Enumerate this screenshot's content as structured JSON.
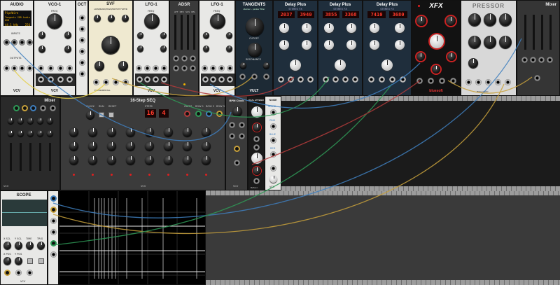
{
  "rack": {
    "accent": "#f5b400",
    "cable_colors": [
      "#3f7fbf",
      "#2f9a57",
      "#c8a13b",
      "#b43b3b",
      "#e6d04a"
    ]
  },
  "audio": {
    "title": "AUDIO",
    "device": "PipeWire",
    "driver": "Tangents SDR Audio USB",
    "rate": "44.1 kHz",
    "block": "256",
    "inputs_label": "INPUTS",
    "outputs_label": "OUTPUTS",
    "brand": "VCV"
  },
  "vco": {
    "title": "VCO-1",
    "freq": "FREQ",
    "fine": "FINE",
    "pwm": "PWM",
    "fm": "FM CV",
    "pw": "PULSE WIDTH",
    "outs": [
      "SIN",
      "TRI",
      "SAW",
      "SQR"
    ],
    "brand": "VCV"
  },
  "oct": {
    "title": "OCT"
  },
  "filter": {
    "title": "SVF",
    "name": "LOW/BAND/HIGH/NOTCH FILTER",
    "knobs": [
      "FREQUENCY",
      "RESONANCE"
    ],
    "brand": "EXPERIMENTAL"
  },
  "lfo1": {
    "title": "LFO-1",
    "freq": "FREQ",
    "brand": "VCV"
  },
  "adsr": {
    "title": "ADSR",
    "labels": [
      "ATT",
      "DEC",
      "SUS",
      "REL"
    ]
  },
  "lfo2": {
    "title": "LFO-1",
    "freq": "FREQ",
    "brand": "VCV"
  },
  "tangents": {
    "title": "TANGENTS",
    "subtitle": "steiner - parker filter",
    "knobs": [
      "CUTOFF",
      "RESONANCE",
      "COLOR"
    ],
    "brand": "VULT"
  },
  "delays": [
    {
      "title": "Delay Plus",
      "sub": "STEREO FX",
      "time": "2037",
      "fb": "3940",
      "knobs": [
        "TIME",
        "FEEDBACK",
        "DRY/WET",
        "MIX"
      ]
    },
    {
      "title": "Delay Plus",
      "sub": "STEREO FX",
      "time": "3855",
      "fb": "3368",
      "knobs": [
        "TIME",
        "FEEDBACK",
        "DRY/WET",
        "MIX"
      ]
    },
    {
      "title": "Delay Plus",
      "sub": "STEREO FX",
      "time": "7410",
      "fb": "3680",
      "knobs": [
        "TIME",
        "FEEDBACK",
        "DRY/WET",
        "MIX"
      ]
    }
  ],
  "xfx": {
    "title": "XFX",
    "labels": [
      "TIME",
      "ENABLE",
      "X-FADE",
      "DAMP",
      "DELAY",
      "X-WAVE",
      "MIX",
      "MAX"
    ],
    "brand": "bluesoft"
  },
  "pressor": {
    "title": "PRESSOR",
    "labels": [
      "THRESHOLD",
      "RATIO",
      "ATTACK",
      "RELEASE",
      "IN GAIN",
      "KNEE",
      "OUT GAIN"
    ],
    "brand": "BOGAUDIO"
  },
  "mixer_top": {
    "title": "Mixer"
  },
  "mixer_left": {
    "title": "Mixer",
    "brand": "VCV"
  },
  "seq": {
    "title": "16-Step SEQ",
    "steps_display": "16",
    "run_display": "4",
    "labels": [
      "CLOCK",
      "RUN",
      "RESET",
      "STEPS",
      "GATES",
      "ROW 1",
      "ROW 2",
      "ROW 3"
    ],
    "brand": "VCV"
  },
  "bpm": {
    "title": "BPM Clock",
    "brand": "VCV"
  },
  "attenuverter": {
    "title": "DUAL ATTENUVERTER",
    "labels": [
      "ATTENUVERTER",
      "OFFSET"
    ],
    "brand": "Befaco"
  },
  "noise": {
    "title": "NOISE",
    "labels": [
      "WHITE",
      "PINK",
      "BLUE",
      "RED"
    ],
    "brand": "VCV"
  },
  "scope": {
    "title": "SCOPE",
    "labels": [
      "X SCL",
      "Y SCL",
      "X POS",
      "Y POS",
      "TIME",
      "TRIG",
      "X IN",
      "Y IN",
      "TRIG IN"
    ],
    "brand": "VCV"
  }
}
